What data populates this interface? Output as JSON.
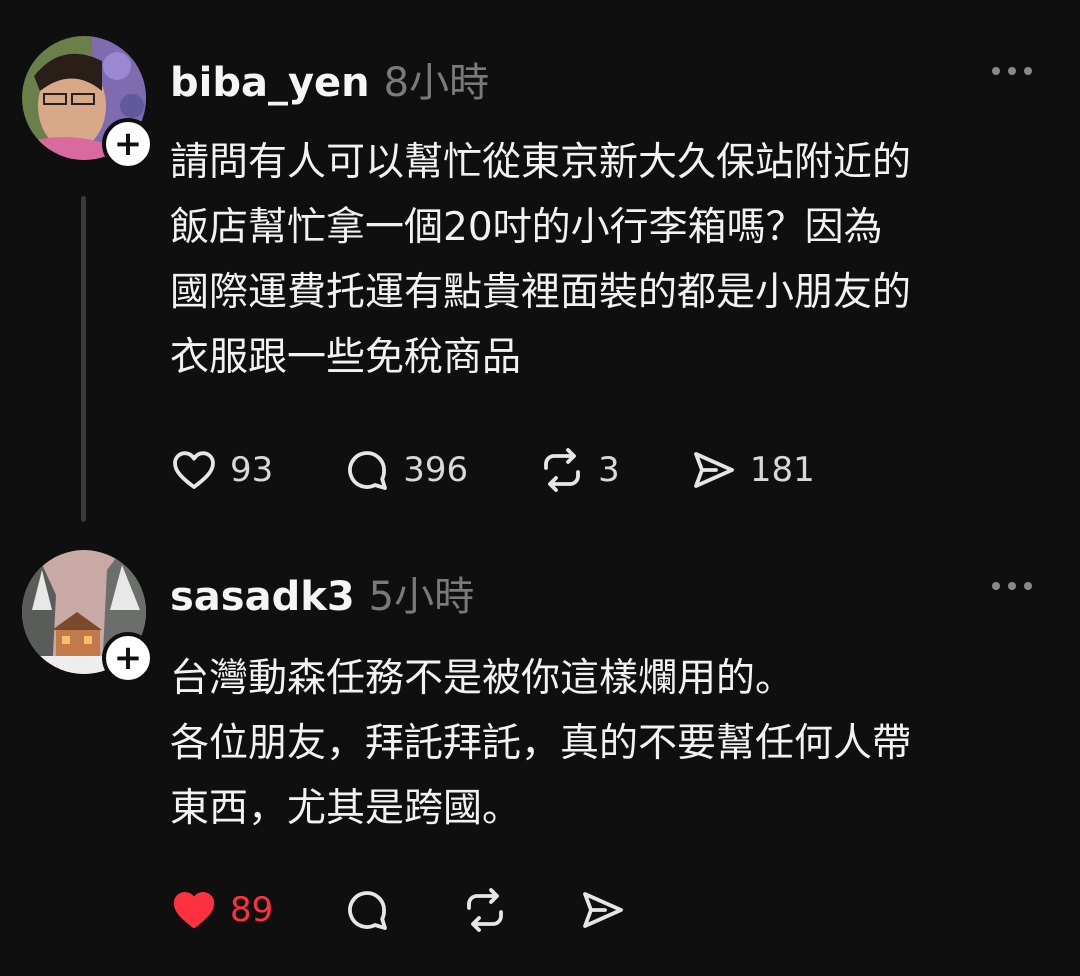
{
  "posts": [
    {
      "username": "biba_yen",
      "time": "8小時",
      "text": "請問有人可以幫忙從東京新大久保站附近的\n飯店幫忙拿一個20吋的小行李箱嗎？因為\n國際運費托運有點貴裡面裝的都是小朋友的\n衣服跟一些免稅商品",
      "likes": "93",
      "replies": "396",
      "reposts": "3",
      "shares": "181"
    },
    {
      "username": "sasadk3",
      "time": "5小時",
      "text": "台灣動森任務不是被你這樣爛用的。\n各位朋友，拜託拜託，真的不要幫任何人帶\n東西，尤其是跨國。",
      "likes": "89",
      "liked": true
    }
  ],
  "icons": {
    "like": "heart-icon",
    "reply": "comment-bubble-icon",
    "repost": "repost-arrows-icon",
    "share": "send-icon",
    "more": "more-dots-icon",
    "follow": "plus-icon"
  },
  "colors": {
    "background": "#0f0f10",
    "liked": "#ff3040",
    "muted": "#7a7a7a"
  }
}
